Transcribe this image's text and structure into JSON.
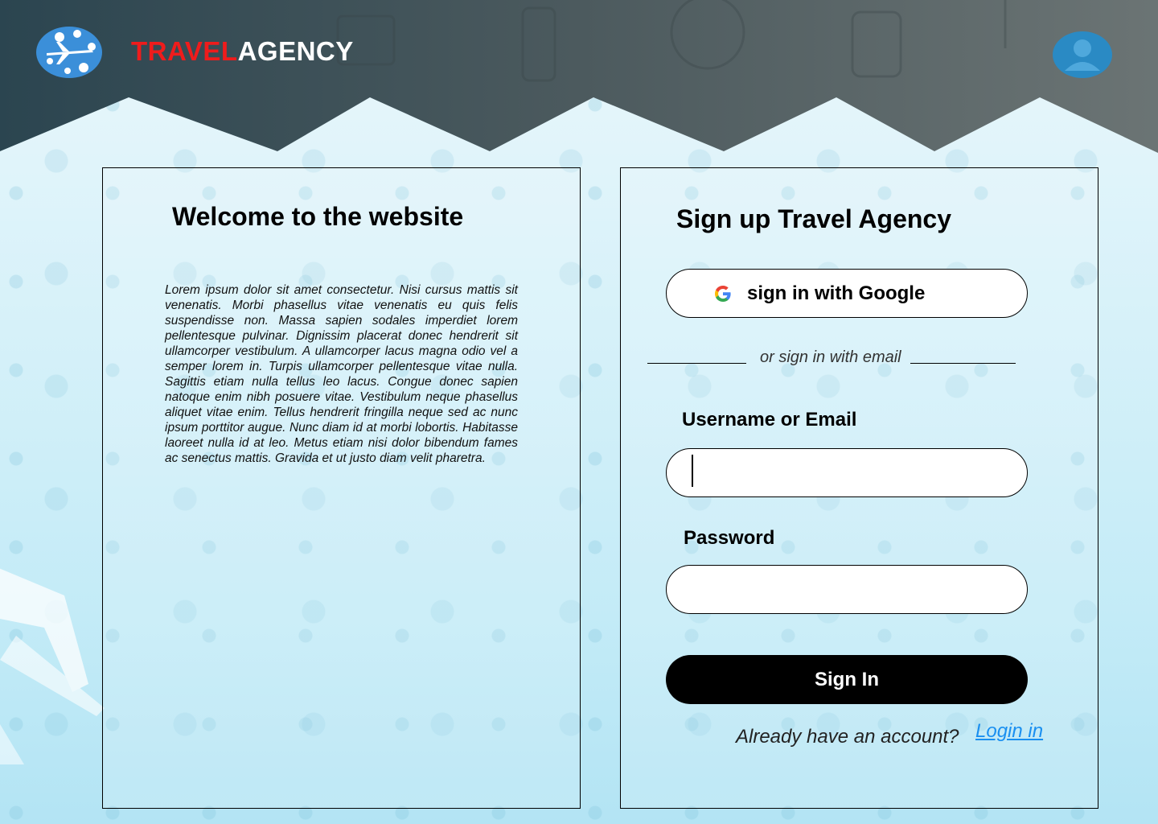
{
  "header": {
    "brand_part1": "TRAVEL",
    "brand_part2": "AGENCY",
    "logo_icon": "airplane-globe-logo",
    "avatar_icon": "user-avatar-icon"
  },
  "welcome": {
    "title": "Welcome to the website",
    "body": "Lorem ipsum dolor sit amet consectetur. Nisi cursus mattis sit venenatis. Morbi phasellus vitae venenatis eu quis felis suspendisse non. Massa sapien sodales imperdiet lorem pellentesque pulvinar. Dignissim placerat donec hendrerit sit ullamcorper vestibulum. A ullamcorper lacus magna odio vel a semper lorem in. Turpis ullamcorper pellentesque vitae nulla. Sagittis etiam nulla tellus leo lacus. Congue donec sapien natoque enim nibh posuere vitae. Vestibulum neque phasellus aliquet vitae enim. Tellus hendrerit fringilla neque sed ac nunc ipsum porttitor augue. Nunc diam id at morbi lobortis. Habitasse laoreet nulla id at leo. Metus etiam nisi dolor bibendum fames ac senectus mattis. Gravida et ut justo diam velit pharetra."
  },
  "signup": {
    "title": "Sign up Travel Agency",
    "google_label": "sign in with Google",
    "divider_text": "or sign in with email",
    "username_label": "Username or Email",
    "username_value": "",
    "password_label": "Password",
    "password_value": "",
    "signin_label": "Sign In",
    "already_text": "Already have an account?",
    "login_link": "Login in"
  },
  "colors": {
    "brand_red": "#ef1c1c",
    "header_dark": "#2f4a55",
    "link_blue": "#1a8ff0",
    "avatar_blue": "#2a8ac4"
  }
}
